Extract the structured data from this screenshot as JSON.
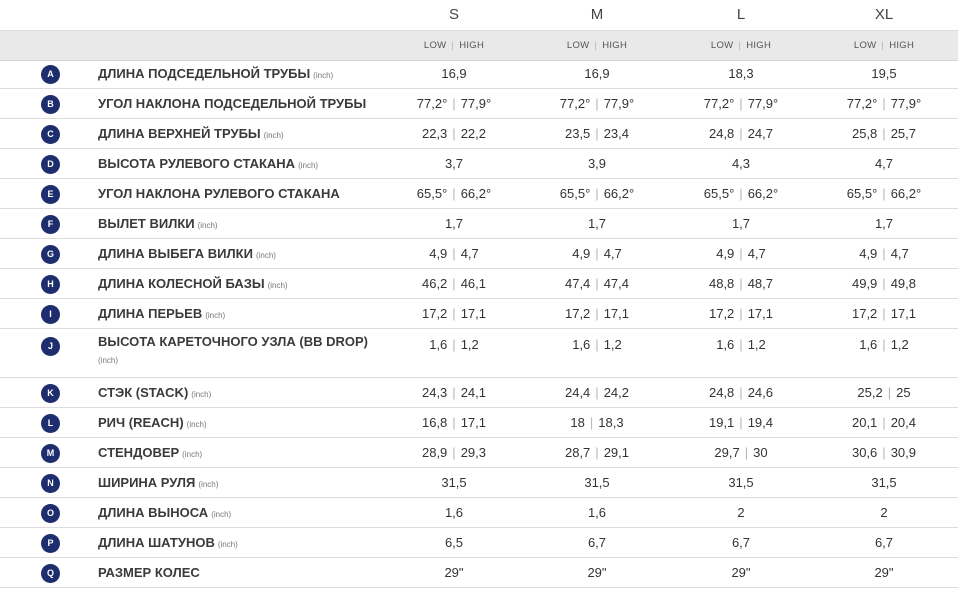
{
  "sizes": [
    "S",
    "M",
    "L",
    "XL"
  ],
  "low_label": "LOW",
  "high_label": "HIGH",
  "rows": [
    {
      "letter": "A",
      "label": "ДЛИНА ПОДСЕДЕЛЬНОЙ ТРУБЫ",
      "unit": "(inch)",
      "values": [
        [
          "16,9"
        ],
        [
          "16,9"
        ],
        [
          "18,3"
        ],
        [
          "19,5"
        ]
      ]
    },
    {
      "letter": "B",
      "label": "УГОЛ НАКЛОНА ПОДСЕДЕЛЬНОЙ ТРУБЫ",
      "unit": "",
      "values": [
        [
          "77,2°",
          "77,9°"
        ],
        [
          "77,2°",
          "77,9°"
        ],
        [
          "77,2°",
          "77,9°"
        ],
        [
          "77,2°",
          "77,9°"
        ]
      ]
    },
    {
      "letter": "C",
      "label": "ДЛИНА ВЕРХНЕЙ ТРУБЫ",
      "unit": "(inch)",
      "values": [
        [
          "22,3",
          "22,2"
        ],
        [
          "23,5",
          "23,4"
        ],
        [
          "24,8",
          "24,7"
        ],
        [
          "25,8",
          "25,7"
        ]
      ]
    },
    {
      "letter": "D",
      "label": "ВЫСОТА РУЛЕВОГО СТАКАНА",
      "unit": "(inch)",
      "values": [
        [
          "3,7"
        ],
        [
          "3,9"
        ],
        [
          "4,3"
        ],
        [
          "4,7"
        ]
      ]
    },
    {
      "letter": "E",
      "label": "УГОЛ НАКЛОНА РУЛЕВОГО СТАКАНА",
      "unit": "",
      "values": [
        [
          "65,5°",
          "66,2°"
        ],
        [
          "65,5°",
          "66,2°"
        ],
        [
          "65,5°",
          "66,2°"
        ],
        [
          "65,5°",
          "66,2°"
        ]
      ]
    },
    {
      "letter": "F",
      "label": "ВЫЛЕТ ВИЛКИ",
      "unit": "(inch)",
      "values": [
        [
          "1,7"
        ],
        [
          "1,7"
        ],
        [
          "1,7"
        ],
        [
          "1,7"
        ]
      ]
    },
    {
      "letter": "G",
      "label": "ДЛИНА ВЫБЕГА ВИЛКИ",
      "unit": "(inch)",
      "values": [
        [
          "4,9",
          "4,7"
        ],
        [
          "4,9",
          "4,7"
        ],
        [
          "4,9",
          "4,7"
        ],
        [
          "4,9",
          "4,7"
        ]
      ]
    },
    {
      "letter": "H",
      "label": "ДЛИНА КОЛЕСНОЙ БАЗЫ",
      "unit": "(inch)",
      "values": [
        [
          "46,2",
          "46,1"
        ],
        [
          "47,4",
          "47,4"
        ],
        [
          "48,8",
          "48,7"
        ],
        [
          "49,9",
          "49,8"
        ]
      ]
    },
    {
      "letter": "I",
      "label": "ДЛИНА ПЕРЬЕВ",
      "unit": "(inch)",
      "values": [
        [
          "17,2",
          "17,1"
        ],
        [
          "17,2",
          "17,1"
        ],
        [
          "17,2",
          "17,1"
        ],
        [
          "17,2",
          "17,1"
        ]
      ]
    },
    {
      "letter": "J",
      "label": "ВЫСОТА КАРЕТОЧНОГО УЗЛА (BB DROP)",
      "unit": "(inch)",
      "unit_newline": true,
      "values": [
        [
          "1,6",
          "1,2"
        ],
        [
          "1,6",
          "1,2"
        ],
        [
          "1,6",
          "1,2"
        ],
        [
          "1,6",
          "1,2"
        ]
      ]
    },
    {
      "letter": "K",
      "label": "СТЭК (STACK)",
      "unit": "(inch)",
      "values": [
        [
          "24,3",
          "24,1"
        ],
        [
          "24,4",
          "24,2"
        ],
        [
          "24,8",
          "24,6"
        ],
        [
          "25,2",
          "25"
        ]
      ]
    },
    {
      "letter": "L",
      "label": "РИЧ (REACH)",
      "unit": "(inch)",
      "values": [
        [
          "16,8",
          "17,1"
        ],
        [
          "18",
          "18,3"
        ],
        [
          "19,1",
          "19,4"
        ],
        [
          "20,1",
          "20,4"
        ]
      ]
    },
    {
      "letter": "M",
      "label": "СТЕНДОВЕР",
      "unit": "(inch)",
      "values": [
        [
          "28,9",
          "29,3"
        ],
        [
          "28,7",
          "29,1"
        ],
        [
          "29,7",
          "30"
        ],
        [
          "30,6",
          "30,9"
        ]
      ]
    },
    {
      "letter": "N",
      "label": "ШИРИНА РУЛЯ",
      "unit": "(inch)",
      "values": [
        [
          "31,5"
        ],
        [
          "31,5"
        ],
        [
          "31,5"
        ],
        [
          "31,5"
        ]
      ]
    },
    {
      "letter": "O",
      "label": "ДЛИНА ВЫНОСА",
      "unit": "(inch)",
      "values": [
        [
          "1,6"
        ],
        [
          "1,6"
        ],
        [
          "2"
        ],
        [
          "2"
        ]
      ]
    },
    {
      "letter": "P",
      "label": "ДЛИНА ШАТУНОВ",
      "unit": "(inch)",
      "values": [
        [
          "6,5"
        ],
        [
          "6,7"
        ],
        [
          "6,7"
        ],
        [
          "6,7"
        ]
      ]
    },
    {
      "letter": "Q",
      "label": "РАЗМЕР КОЛЕС",
      "unit": "",
      "values": [
        [
          "29\""
        ],
        [
          "29\""
        ],
        [
          "29\""
        ],
        [
          "29\""
        ]
      ]
    }
  ],
  "colors": {
    "badge": "#1d2d6e",
    "header_band": "#e9e9e9",
    "row_border": "#dcdcdc"
  }
}
